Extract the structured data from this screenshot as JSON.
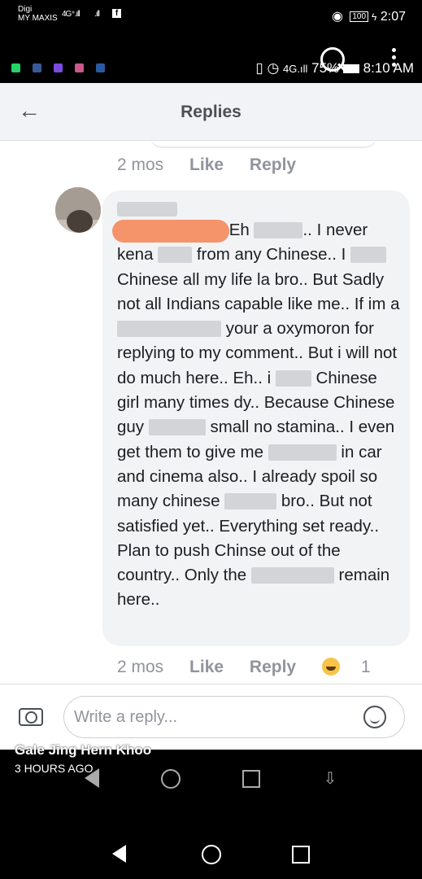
{
  "status_bar_top": {
    "carrier_line1": "Digi",
    "carrier_line2": "MY MAXIS",
    "network1": "4G⁺.ıll",
    "network2": ".ıll",
    "battery": "100",
    "time": "2:07"
  },
  "status_bar_second": {
    "battery_percent": "75%",
    "time": "8:10 AM",
    "app_icon_colors": [
      "#25d366",
      "#3b5998",
      "#7a4be0",
      "#c85a8a",
      "#2c5aa0"
    ]
  },
  "header": {
    "title": "Replies",
    "back_icon": "arrow-left-icon"
  },
  "prev_reply_actions": {
    "time": "2 mos",
    "like": "Like",
    "reply": "Reply"
  },
  "comment": {
    "segments": [
      {
        "text": "Eh "
      },
      {
        "blur": 60
      },
      {
        "text": ".. I never kena "
      },
      {
        "blur": 42
      },
      {
        "text": " from any Chinese.. I "
      },
      {
        "blur": 44
      },
      {
        "text": " Chinese all my life la bro.. But Sadly not all Indians capable like me.. If im a "
      },
      {
        "blur": 128
      },
      {
        "text": " your a oxymoron for replying to my comment.. But i will not do much here.. Eh.. i "
      },
      {
        "blur": 44
      },
      {
        "text": " Chinese girl many times dy.. Because Chinese guy "
      },
      {
        "blur": 70
      },
      {
        "text": " small no stamina.. I even get them to give me "
      },
      {
        "blur": 84
      },
      {
        "text": " in car and cinema also.. I already spoil so many chinese "
      },
      {
        "blur": 64
      },
      {
        "text": " bro.. But not satisfied yet.. Everything set ready.. Plan to push Chinse out of the country.. Only the "
      },
      {
        "blur": 102
      },
      {
        "text": " remain here.."
      }
    ]
  },
  "comment_actions": {
    "time": "2 mos",
    "like": "Like",
    "reply": "Reply",
    "reaction_icon": "haha-emoji-icon",
    "reaction_count": "1"
  },
  "composer": {
    "placeholder": "Write a reply..."
  },
  "overlay": {
    "name": "Gale Jing Hern Khoo",
    "time": "3 HOURS AGO"
  }
}
